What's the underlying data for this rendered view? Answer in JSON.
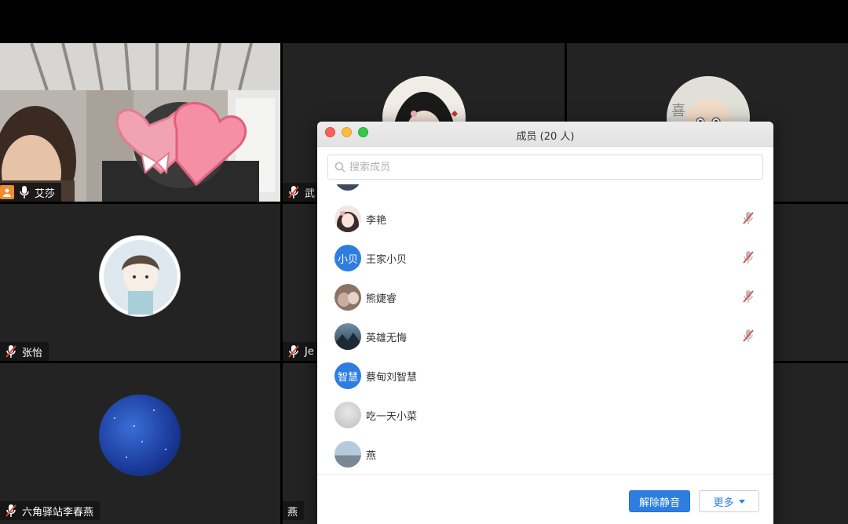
{
  "participants": [
    {
      "name": "艾莎",
      "mic": "on",
      "host": true
    },
    {
      "name": "武",
      "mic": "muted"
    },
    {
      "name": "张怡",
      "mic": "muted"
    },
    {
      "name": "Je",
      "mic": "muted"
    },
    {
      "name": "六角驿站李春燕",
      "mic": "muted"
    },
    {
      "name": "燕",
      "mic": "none"
    }
  ],
  "members_panel": {
    "title": "成员 (20 人)",
    "search_placeholder": "搜索成员",
    "members": [
      {
        "name": "李艳",
        "avatar_text": "",
        "avatar_kind": "photo-girl",
        "muted": true
      },
      {
        "name": "王家小贝",
        "avatar_text": "小贝",
        "avatar_kind": "blue",
        "muted": true
      },
      {
        "name": "熊婕睿",
        "avatar_text": "",
        "avatar_kind": "photo-brown",
        "muted": true
      },
      {
        "name": "英雄无悔",
        "avatar_text": "",
        "avatar_kind": "photo-landscape",
        "muted": true
      },
      {
        "name": "蔡甸刘智慧",
        "avatar_text": "智慧",
        "avatar_kind": "blue",
        "muted": false
      },
      {
        "name": "吃一天小菜",
        "avatar_text": "",
        "avatar_kind": "photo-grey",
        "muted": false
      },
      {
        "name": "燕",
        "avatar_text": "",
        "avatar_kind": "photo-sky",
        "muted": false
      }
    ],
    "unmute_all_label": "解除静音",
    "more_label": "更多"
  },
  "colors": {
    "accent": "#2e7de1",
    "muted_mic": "#d9534f",
    "host_badge": "#f08c2e"
  }
}
